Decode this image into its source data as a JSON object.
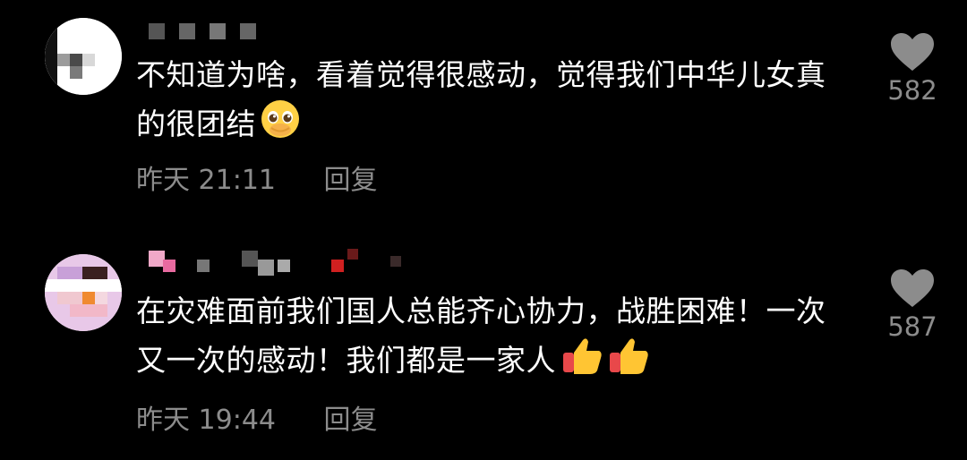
{
  "comments": [
    {
      "text": "不知道为啥，看着觉得很感动，觉得我们中华儿女真的很团结",
      "emoji": "pleading-face-hands-over-mouth",
      "time": "昨天 21:11",
      "reply_label": "回复",
      "likes": "582"
    },
    {
      "text": "在灾难面前我们国人总能齐心协力，战胜困难！一次又一次的感动！我们都是一家人",
      "emoji": "thumbs-up-x2",
      "time": "昨天 19:44",
      "reply_label": "回复",
      "likes": "587"
    }
  ],
  "colors": {
    "background": "#000000",
    "meta_text": "#8c8c8c",
    "heart": "#8c8c8c"
  }
}
